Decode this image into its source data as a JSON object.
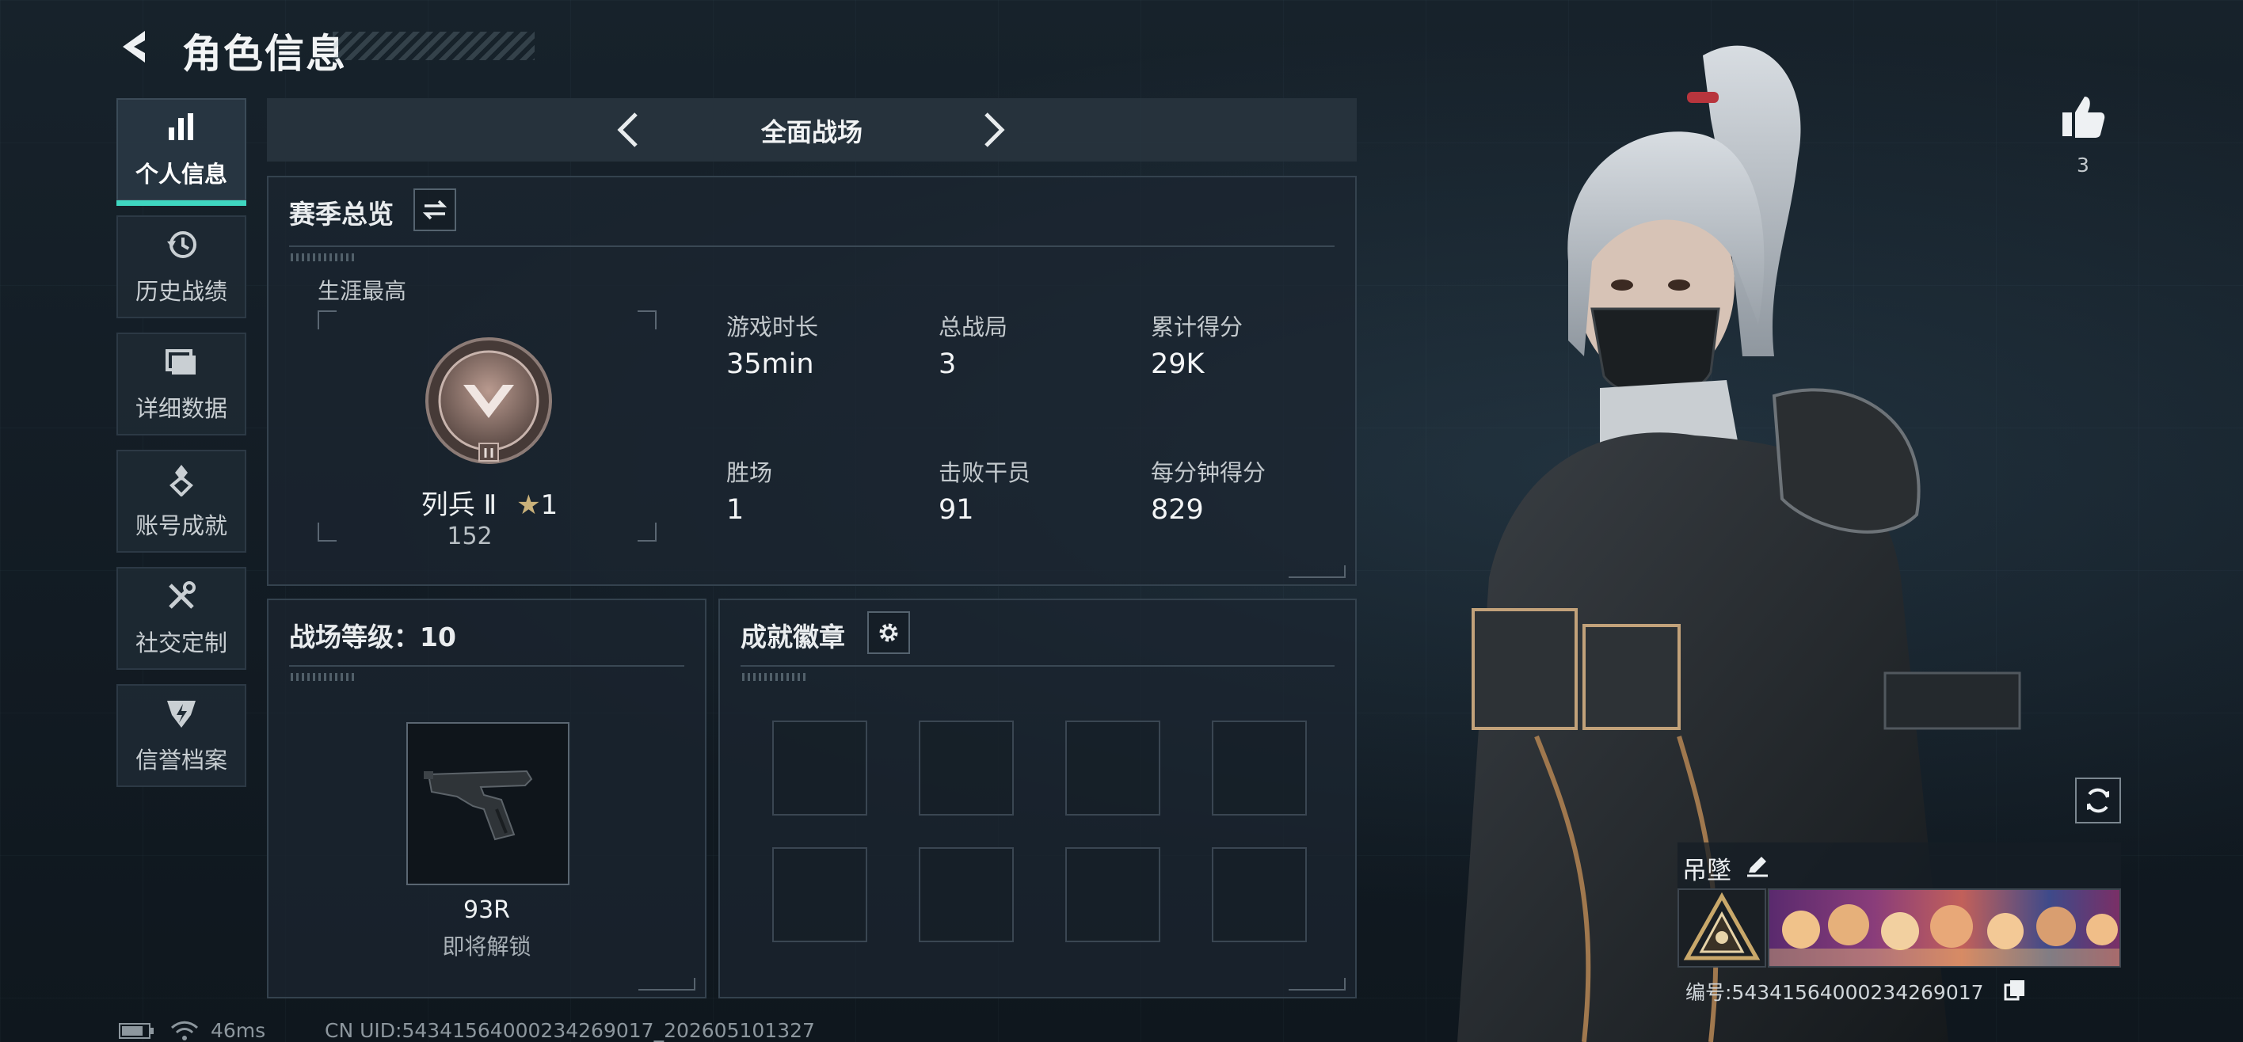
{
  "header": {
    "title": "角色信息"
  },
  "nav": {
    "items": [
      {
        "label": "个人信息",
        "icon": "bar-chart-icon",
        "active": true
      },
      {
        "label": "历史战绩",
        "icon": "history-clock-icon",
        "active": false
      },
      {
        "label": "详细数据",
        "icon": "folder-icon",
        "active": false
      },
      {
        "label": "账号成就",
        "icon": "achievement-icon",
        "active": false
      },
      {
        "label": "社交定制",
        "icon": "tools-icon",
        "active": false
      },
      {
        "label": "信誉档案",
        "icon": "shield-lightning-icon",
        "active": false
      }
    ]
  },
  "mode": {
    "label": "全面战场"
  },
  "season": {
    "title": "赛季总览",
    "career_label": "生涯最高",
    "rank_name": "列兵 Ⅱ",
    "rank_stars": "1",
    "rank_points": "152",
    "stats": [
      {
        "label": "游戏时长",
        "value": "35min"
      },
      {
        "label": "总战局",
        "value": "3"
      },
      {
        "label": "累计得分",
        "value": "29K"
      },
      {
        "label": "胜场",
        "value": "1"
      },
      {
        "label": "击败干员",
        "value": "91"
      },
      {
        "label": "每分钟得分",
        "value": "829"
      }
    ]
  },
  "level": {
    "title": "战场等级：10",
    "weapon_name": "93R",
    "weapon_status": "即将解锁"
  },
  "badges": {
    "title": "成就徽章",
    "slot_count": 8
  },
  "character": {
    "likes": "3",
    "name": "吊墜",
    "id_text": "编号:5434156400023426901​7"
  },
  "status_bar": {
    "ping": "46ms",
    "uid": "CN UID:54341564000234269017_202605101327"
  },
  "colors": {
    "accent": "#3fd6c0",
    "panel_border": "#34424e",
    "background": "#131c24"
  }
}
